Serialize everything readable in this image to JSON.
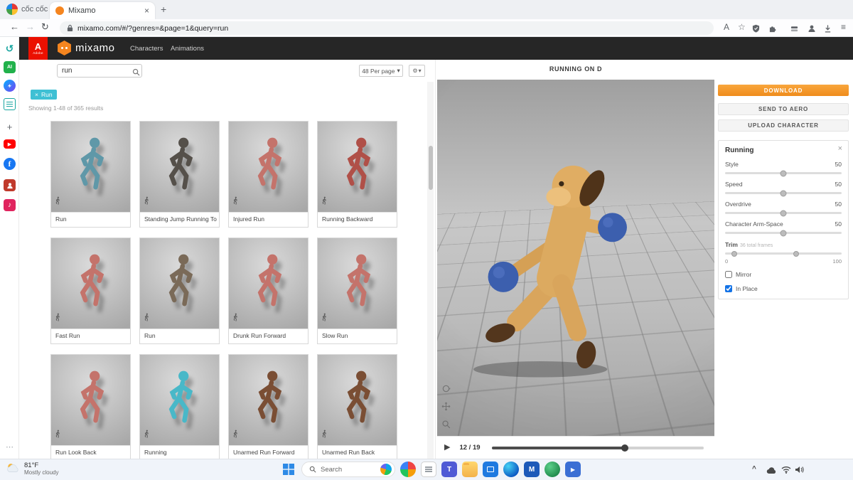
{
  "browser": {
    "brand": "cốc cốc",
    "tab_title": "Mixamo",
    "url": "mixamo.com/#/?genres=&page=1&query=run"
  },
  "glyphs": {
    "back": "←",
    "forward": "→",
    "reload": "↻",
    "plus": "+",
    "close": "×",
    "star": "☆",
    "menu": "≡",
    "caret_down": "▾",
    "gear": "⚙",
    "play": "▶",
    "more_h": "⋯",
    "chevron_up": "^",
    "history": "↺",
    "note": "♪",
    "facebook": "f",
    "ai": "AI",
    "adobe_a": "A",
    "adobe_word": "Adobe",
    "teams_t": "T",
    "word_m": "M",
    "youtube_play": "▶",
    "media_play": "▶"
  },
  "app_header": {
    "logo": "mixamo",
    "nav": [
      {
        "label": "Characters"
      },
      {
        "label": "Animations"
      }
    ]
  },
  "toolbar": {
    "search_value": "run",
    "per_page": "48 Per page"
  },
  "filters": {
    "chip_label": "Run",
    "results": "Showing 1-48 of 365 results"
  },
  "cards": [
    {
      "label": "Run",
      "color": "#5f98a8"
    },
    {
      "label": "Standing Jump Running To",
      "color": "#55504a"
    },
    {
      "label": "Injured Run",
      "color": "#c4736b"
    },
    {
      "label": "Running Backward",
      "color": "#b05048"
    },
    {
      "label": "Fast Run",
      "color": "#c4736b"
    },
    {
      "label": "Run",
      "color": "#7a6a58"
    },
    {
      "label": "Drunk Run Forward",
      "color": "#c4736b"
    },
    {
      "label": "Slow Run",
      "color": "#c4736b"
    },
    {
      "label": "Run Look Back",
      "color": "#c4736b"
    },
    {
      "label": "Running",
      "color": "#49b8c8"
    },
    {
      "label": "Unarmed Run Forward",
      "color": "#7a4e34"
    },
    {
      "label": "Unarmed Run Back",
      "color": "#7a4e34"
    }
  ],
  "viewport": {
    "title": "RUNNING ON D",
    "frame_counter": "12 / 19",
    "progress_pct": "63%"
  },
  "controls": {
    "download": "DOWNLOAD",
    "send_to_aero": "SEND TO AERO",
    "upload_character": "UPLOAD CHARACTER",
    "panel_title": "Running",
    "sliders": [
      {
        "label": "Style",
        "value": "50",
        "pos": "50%"
      },
      {
        "label": "Speed",
        "value": "50",
        "pos": "50%"
      },
      {
        "label": "Overdrive",
        "value": "50",
        "pos": "50%"
      },
      {
        "label": "Character Arm-Space",
        "value": "50",
        "pos": "50%"
      }
    ],
    "trim": {
      "label": "Trim",
      "frames_note": "36 total frames",
      "min": "0",
      "max": "100",
      "start_pos": "8%",
      "end_pos": "61%"
    },
    "checkboxes": [
      {
        "label": "Mirror",
        "checked": false
      },
      {
        "label": "In Place",
        "checked": true
      }
    ]
  },
  "colors": {
    "accent_orange": "#f7941e",
    "chip_cyan": "#3fc0d4",
    "adobe_red": "#eb1000",
    "check_blue": "#1473e6"
  },
  "taskbar": {
    "weather_temp": "81°F",
    "weather_desc": "Mostly cloudy",
    "search_placeholder": "Search"
  }
}
